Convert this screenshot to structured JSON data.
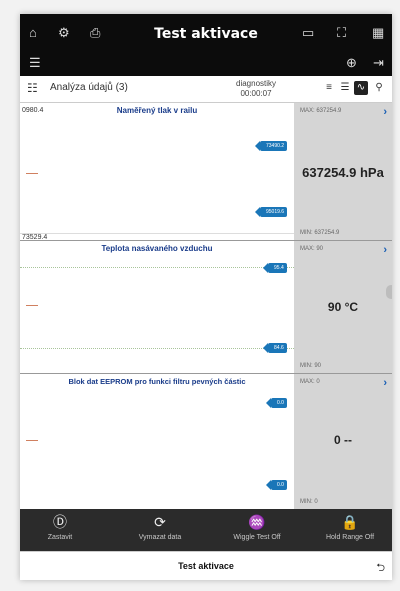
{
  "app": {
    "title": "Test aktivace",
    "top_icons": [
      "home-icon",
      "engine-icon",
      "export-icon",
      "battery-icon",
      "fullscreen-icon",
      "grid-icon",
      "settings-icon",
      "ecg-icon",
      "exit-icon"
    ]
  },
  "subbar": {
    "label": "Analýza údajů (3)",
    "diag_line1": "diagnostiky",
    "diag_line2": "00:00:07"
  },
  "panels": [
    {
      "title": "Naměřený tlak v railu",
      "y_top": "0980.4",
      "y_bottom": "73529.4",
      "tag_high": "73490.2",
      "tag_low": "95019.6",
      "max": "MAX: 637254.9",
      "min": "MIN: 637254.9",
      "value": "637254.9 hPa"
    },
    {
      "title": "Teplota nasávaného vzduchu",
      "tag_high": "95.4",
      "tag_low": "84.6",
      "max": "MAX: 90",
      "min": "MIN: 90",
      "value": "90 °C"
    },
    {
      "title": "Blok dat EEPROM pro funkci filtru pevných částic",
      "tag_high": "0.0",
      "tag_low": "0.0",
      "max": "MAX: 0",
      "min": "MIN: 0",
      "value": "0 --"
    }
  ],
  "toolbar": {
    "stop": "Zastavit",
    "clear": "Vymazat data",
    "wiggle": "Wiggle Test Off",
    "hold": "Hold Range Off"
  },
  "footer": {
    "title": "Test aktivace"
  }
}
